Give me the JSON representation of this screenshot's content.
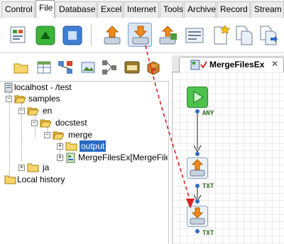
{
  "menu": {
    "tabs": [
      {
        "label": "Control"
      },
      {
        "label": "File"
      },
      {
        "label": "Database"
      },
      {
        "label": "Excel"
      },
      {
        "label": "Internet"
      },
      {
        "label": "Tools"
      },
      {
        "label": "Archive"
      },
      {
        "label": "Record"
      },
      {
        "label": "Stream"
      }
    ],
    "active_tab": "File"
  },
  "toolbar": {
    "icons": [
      "script-icon",
      "start-icon",
      "stop-icon",
      "upload-file-icon",
      "download-file-icon",
      "file-transfer-icon",
      "form-icon",
      "new-file-icon",
      "copy-file-icon",
      "move-file-icon"
    ],
    "active_icon": "download-file-icon"
  },
  "left_tools": [
    "open-folder-icon",
    "table-icon",
    "network-icon",
    "image-icon",
    "flow-icon",
    "excel-icon",
    "box-icon"
  ],
  "tree": {
    "root": "localhost - /test",
    "samples": "samples",
    "en": "en",
    "docstest": "docstest",
    "merge": "merge",
    "output": "output",
    "mergefile": "MergeFilesEx[MergeFile",
    "ja": "ja",
    "local_history": "Local history"
  },
  "editor": {
    "tab_title": "MergeFilesEx",
    "close_glyph": "✕",
    "port_any": "ANY",
    "port_txt_1": "TXT",
    "port_txt_2": "TXT"
  },
  "colors": {
    "selection": "#2a6ac4",
    "drag_arrow": "#e0201e",
    "port_label": "#2d6b1f",
    "start_node": "#4cc24c"
  }
}
